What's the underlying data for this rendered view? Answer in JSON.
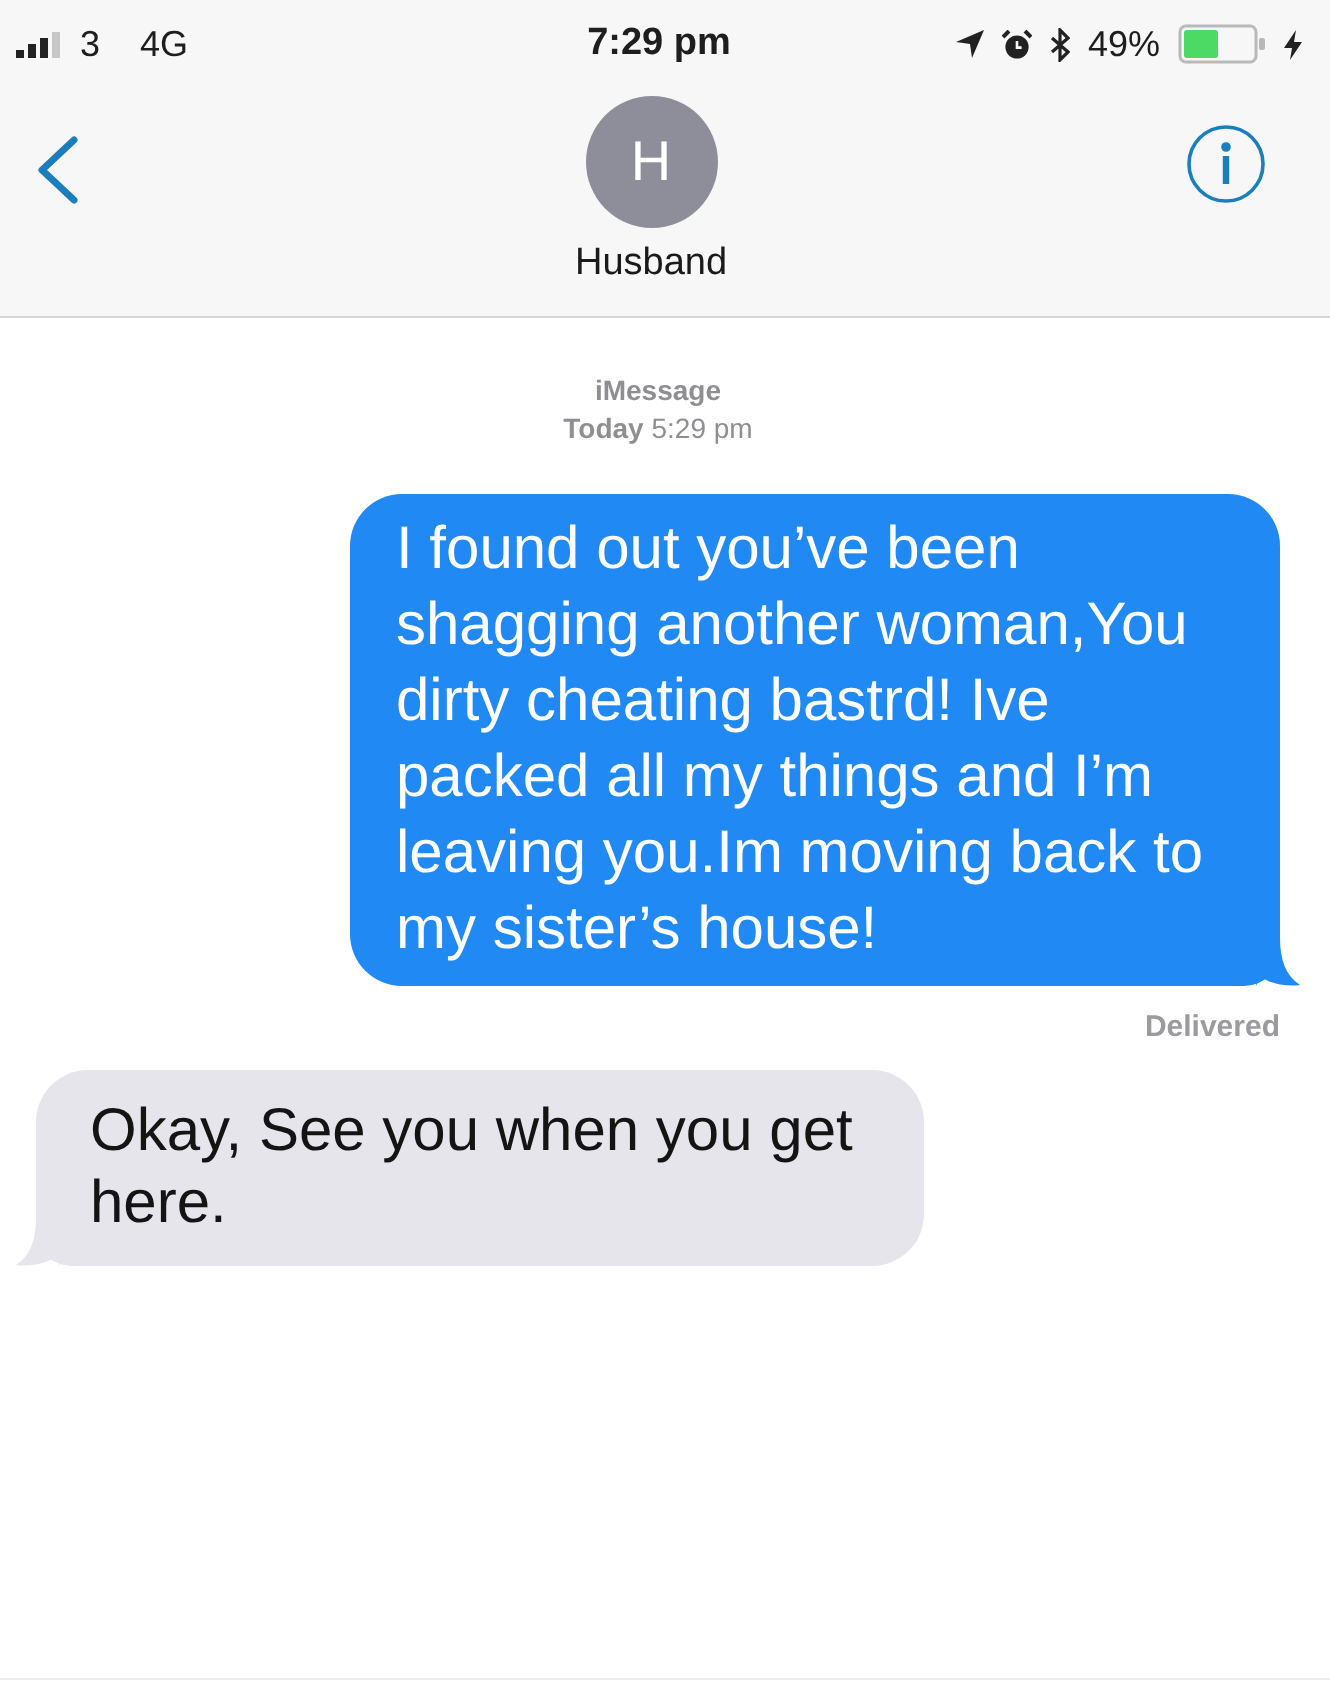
{
  "status_bar": {
    "carrier": "3",
    "network": "4G",
    "time": "7:29 pm",
    "battery": "49%"
  },
  "header": {
    "avatar_initial": "H",
    "contact_name": "Husband"
  },
  "conversation": {
    "service": "iMessage",
    "timestamp": "**Today** 5:29 pm",
    "messages": [
      {
        "kind": "sent",
        "text": "I found out you’ve been shagging another woman,You dirty cheating bastrd! Ive packed all my things and I’m leaving you.Im moving back to my sister’s house!",
        "status": "Delivered"
      },
      {
        "kind": "received",
        "text": "Okay, See you when you get here."
      }
    ]
  }
}
